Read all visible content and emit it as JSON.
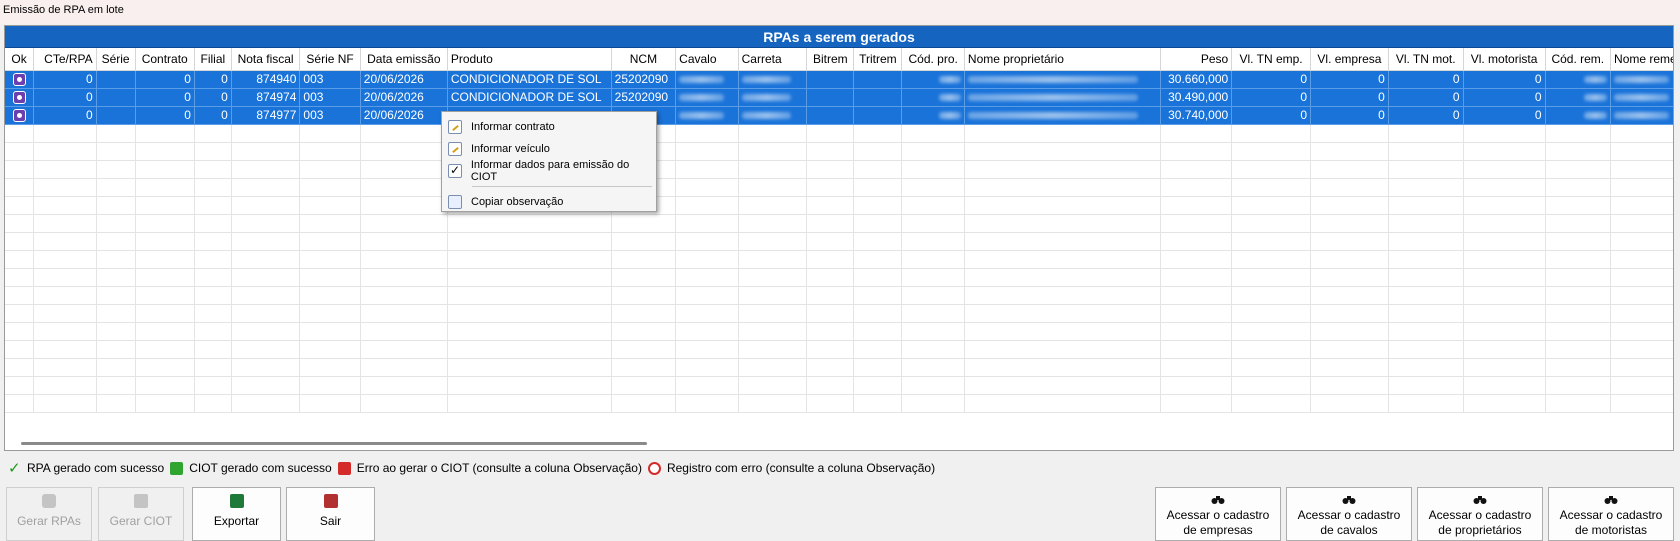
{
  "window": {
    "title": "Emissão de RPA em lote"
  },
  "grid": {
    "caption": "RPAs a serem gerados",
    "columns": [
      "Ok",
      "CTe/RPA",
      "Série",
      "Contrato",
      "Filial",
      "Nota fiscal",
      "Série NF",
      "Data emissão",
      "Produto",
      "NCM",
      "Cavalo",
      "Carreta",
      "Bitrem",
      "Tritrem",
      "Cód. pro.",
      "Nome proprietário",
      "Peso",
      "Vl. TN emp.",
      "Vl. empresa",
      "Vl. TN mot.",
      "Vl. motorista",
      "Cód. rem.",
      "Nome remetente"
    ],
    "rows": [
      {
        "cte": "0",
        "contrato": "0",
        "filial": "0",
        "nota": "874940",
        "serie_nf": "003",
        "data": "20/06/2026",
        "produto": "CONDICIONADOR DE SOL",
        "ncm": "25202090",
        "peso": "30.660,000",
        "vl_tn_emp": "0",
        "vl_empresa": "0",
        "vl_tn_mot": "0",
        "vl_motorista": "0"
      },
      {
        "cte": "0",
        "contrato": "0",
        "filial": "0",
        "nota": "874974",
        "serie_nf": "003",
        "data": "20/06/2026",
        "produto": "CONDICIONADOR DE SOL",
        "ncm": "25202090",
        "peso": "30.490,000",
        "vl_tn_emp": "0",
        "vl_empresa": "0",
        "vl_tn_mot": "0",
        "vl_motorista": "0"
      },
      {
        "cte": "0",
        "contrato": "0",
        "filial": "0",
        "nota": "874977",
        "serie_nf": "003",
        "data": "20/06/2026",
        "produto": "",
        "ncm": "",
        "peso": "30.740,000",
        "vl_tn_emp": "0",
        "vl_empresa": "0",
        "vl_tn_mot": "0",
        "vl_motorista": "0"
      }
    ],
    "selected_color": "#1a73d9",
    "caption_color": "#1565c0"
  },
  "context_menu": {
    "items": [
      "Informar contrato",
      "Informar veículo",
      "Informar dados para emissão do CIOT",
      "Copiar observação"
    ]
  },
  "legend": {
    "items": [
      {
        "label": "RPA gerado com sucesso",
        "icon": "green-check-icon"
      },
      {
        "label": "CIOT gerado com sucesso",
        "icon": "thumbs-up-icon"
      },
      {
        "label": "Erro ao gerar o CIOT (consulte a coluna Observação)",
        "icon": "thumbs-down-icon"
      },
      {
        "label": "Registro com erro (consulte a coluna Observação)",
        "icon": "stop-hand-icon"
      }
    ]
  },
  "buttons": {
    "gerar_rpas": "Gerar RPAs",
    "gerar_ciot": "Gerar CIOT",
    "exportar": "Exportar",
    "sair": "Sair",
    "cad_empresas_1": "Acessar o cadastro",
    "cad_empresas_2": "de empresas",
    "cad_cavalos_1": "Acessar o cadastro",
    "cad_cavalos_2": "de cavalos",
    "cad_proprietarios_1": "Acessar o cadastro",
    "cad_proprietarios_2": "de proprietários",
    "cad_motoristas_1": "Acessar o cadastro",
    "cad_motoristas_2": "de motoristas"
  }
}
